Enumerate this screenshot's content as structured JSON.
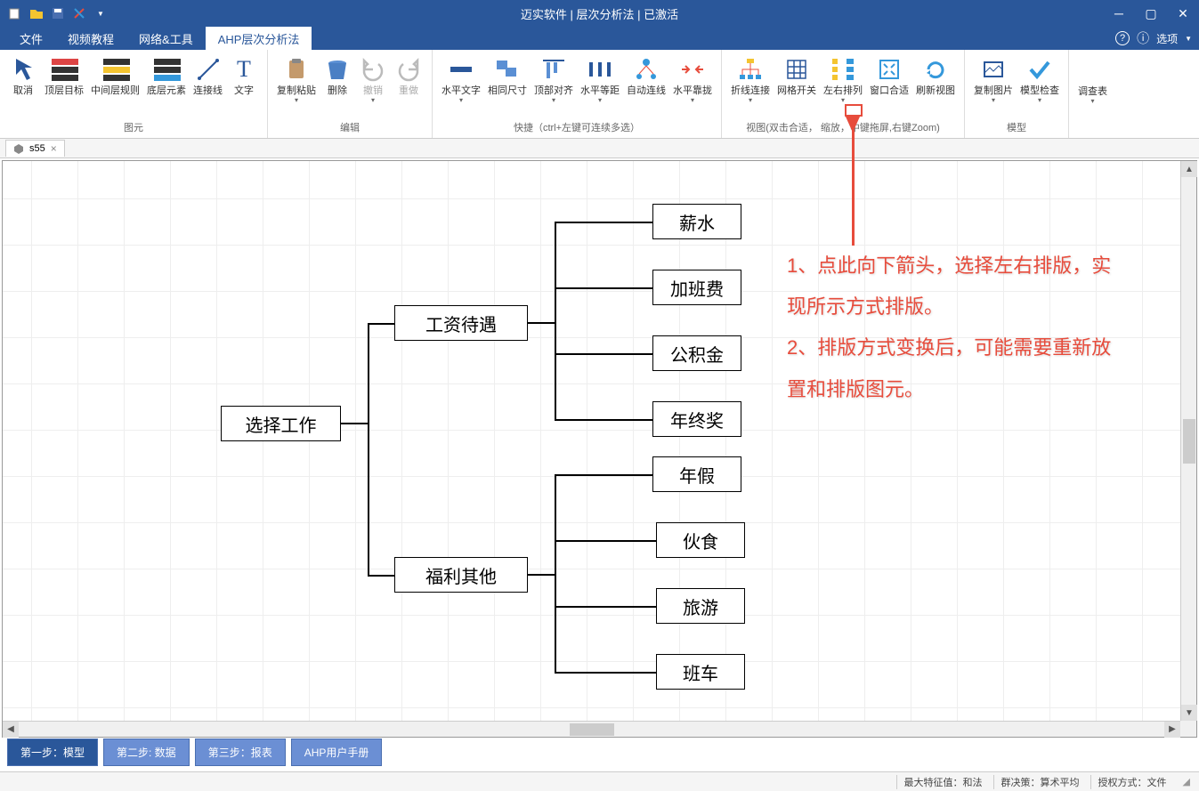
{
  "title": "迈实软件 | 层次分析法 | 已激活",
  "menu": {
    "file": "文件",
    "video": "视频教程",
    "net": "网络&工具",
    "ahp": "AHP层次分析法",
    "help_glyph": "?",
    "options": "选项"
  },
  "ribbon": {
    "groups": {
      "elements": "图元",
      "edit": "编辑",
      "quick": "快捷（ctrl+左键可连续多选）",
      "view": "视图(双击合适，        缩放，中键拖屏,右键Zoom)",
      "model": "模型"
    },
    "btns": {
      "cancel": "取消",
      "top": "顶层目标",
      "mid": "中间层规则",
      "bottom": "底层元素",
      "conn": "连接线",
      "text": "文字",
      "copy": "复制粘贴",
      "del": "删除",
      "undo": "撤销",
      "redo": "重做",
      "htext": "水平文字",
      "samesize": "相同尺寸",
      "topalign": "顶部对齐",
      "hspace": "水平等距",
      "autoconn": "自动连线",
      "hnear": "水平靠拢",
      "foldconn": "折线连接",
      "grid": "网格开关",
      "lralign": "左右排列",
      "fitwin": "窗口合适",
      "refresh": "刷新视图",
      "copyimg": "复制图片",
      "check": "模型检查",
      "survey": "调查表"
    }
  },
  "doctab": {
    "name": "s55",
    "close": "×"
  },
  "nodes": {
    "root": "选择工作",
    "m1": "工资待遇",
    "m2": "福利其他",
    "l1": "薪水",
    "l2": "加班费",
    "l3": "公积金",
    "l4": "年终奖",
    "l5": "年假",
    "l6": "伙食",
    "l7": "旅游",
    "l8": "班车"
  },
  "annot": {
    "text": "1、点此向下箭头，选择左右排版，实现所示方式排版。\n2、排版方式变换后，可能需要重新放置和排版图元。"
  },
  "steps": {
    "s1": "第一步：模型",
    "s2": "第二步: 数据",
    "s3": "第三步：报表",
    "s4": "AHP用户手册"
  },
  "status": {
    "eigen": "最大特征值：和法",
    "group": "群决策：算术平均",
    "auth": "授权方式：文件"
  }
}
